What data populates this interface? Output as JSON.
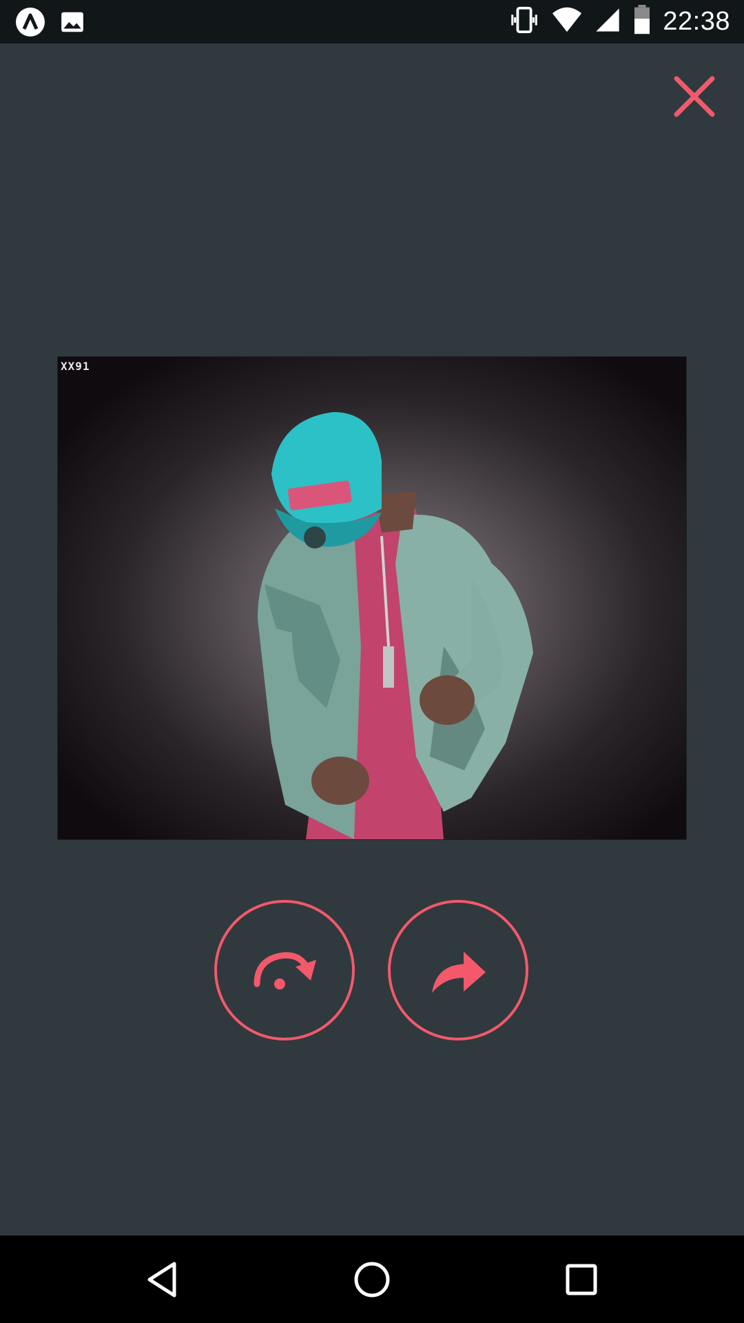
{
  "status_bar": {
    "time": "22:38",
    "left_icons": [
      "app-logo-icon",
      "image-notification-icon"
    ],
    "right_icons": [
      "vibrate-icon",
      "wifi-icon",
      "cell-signal-icon",
      "battery-icon"
    ]
  },
  "close_button": {
    "icon": "close-icon",
    "color": "#f3596b"
  },
  "preview": {
    "watermark": "XX91",
    "description_icon": "photo"
  },
  "actions": [
    {
      "name": "rotate",
      "icon": "rotate-icon"
    },
    {
      "name": "share",
      "icon": "share-icon"
    }
  ],
  "nav_bar": {
    "buttons": [
      "back-icon",
      "home-icon",
      "recents-icon"
    ]
  },
  "colors": {
    "background": "#30393e",
    "accent": "#f3596b",
    "status_bar": "#111619",
    "nav_bar": "#000000"
  }
}
